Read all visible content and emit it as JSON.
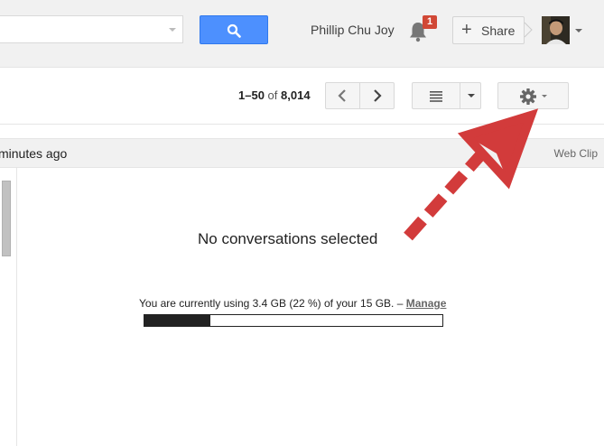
{
  "header": {
    "search": {
      "value": "",
      "placeholder": ""
    },
    "user_name": "Phillip Chu Joy",
    "notification_count": "1",
    "share_label": "Share"
  },
  "toolbar": {
    "range": "1–50",
    "of_label": "of",
    "total": "8,014"
  },
  "conversation_header": {
    "time_text": "minutes ago",
    "web_clip_label": "Web Clip"
  },
  "main": {
    "empty_message": "No conversations selected",
    "storage_text": "You are currently using 3.4 GB (22 %) of your 15 GB. –",
    "manage_label": "Manage",
    "storage_percent": 22
  },
  "colors": {
    "search_button": "#4d90fe",
    "badge": "#d14836",
    "annotation_arrow": "#d23b3b"
  },
  "icons": [
    "search-icon",
    "bell-icon",
    "plus-icon",
    "chevron-left-icon",
    "chevron-right-icon",
    "density-icon",
    "gear-icon"
  ]
}
